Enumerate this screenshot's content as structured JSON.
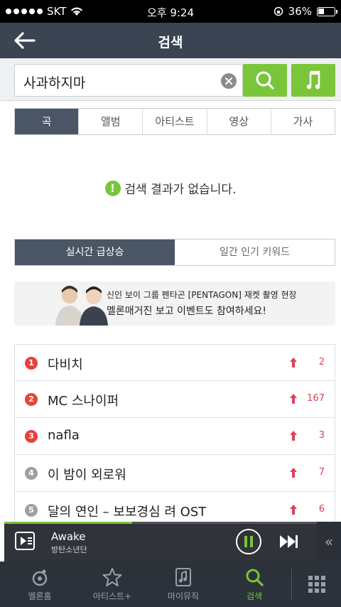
{
  "status": {
    "carrier": "SKT",
    "time": "오후 9:24",
    "battery": "36%"
  },
  "header": {
    "title": "검색"
  },
  "search": {
    "query": "사과하지마"
  },
  "tabs": [
    {
      "label": "곡"
    },
    {
      "label": "앨범"
    },
    {
      "label": "아티스트"
    },
    {
      "label": "영상"
    },
    {
      "label": "가사"
    }
  ],
  "no_result": {
    "message": "검색 결과가 없습니다.",
    "icon_glyph": "!"
  },
  "keyword_tabs": [
    {
      "label": "실시간 급상승"
    },
    {
      "label": "일간 인기 키워드"
    }
  ],
  "banner": {
    "line1": "신인 보이 그룹 펜타곤 [PENTAGON] 재켓 촬영 현장",
    "line2": "멜론매거진 보고 이벤트도 참여하세요!"
  },
  "keywords": [
    {
      "rank": "1",
      "keyword": "다비치",
      "change": "2"
    },
    {
      "rank": "2",
      "keyword": "MC 스나이퍼",
      "change": "167"
    },
    {
      "rank": "3",
      "keyword": "nafla",
      "change": "3"
    },
    {
      "rank": "4",
      "keyword": "이 밤이 외로워",
      "change": "7"
    },
    {
      "rank": "5",
      "keyword": "달의 연인 – 보보경심 려 OST",
      "change": "6"
    }
  ],
  "player": {
    "song": "Awake",
    "artist": "방탄소년단",
    "progress": 0.38,
    "collapse_glyph": "«"
  },
  "nav": [
    {
      "label": "멜론홈"
    },
    {
      "label": "아티스트+"
    },
    {
      "label": "마이뮤직"
    },
    {
      "label": "검색"
    }
  ],
  "colors": {
    "accent": "#7bc53a",
    "header": "#3a4452",
    "rise": "#e0405a"
  }
}
